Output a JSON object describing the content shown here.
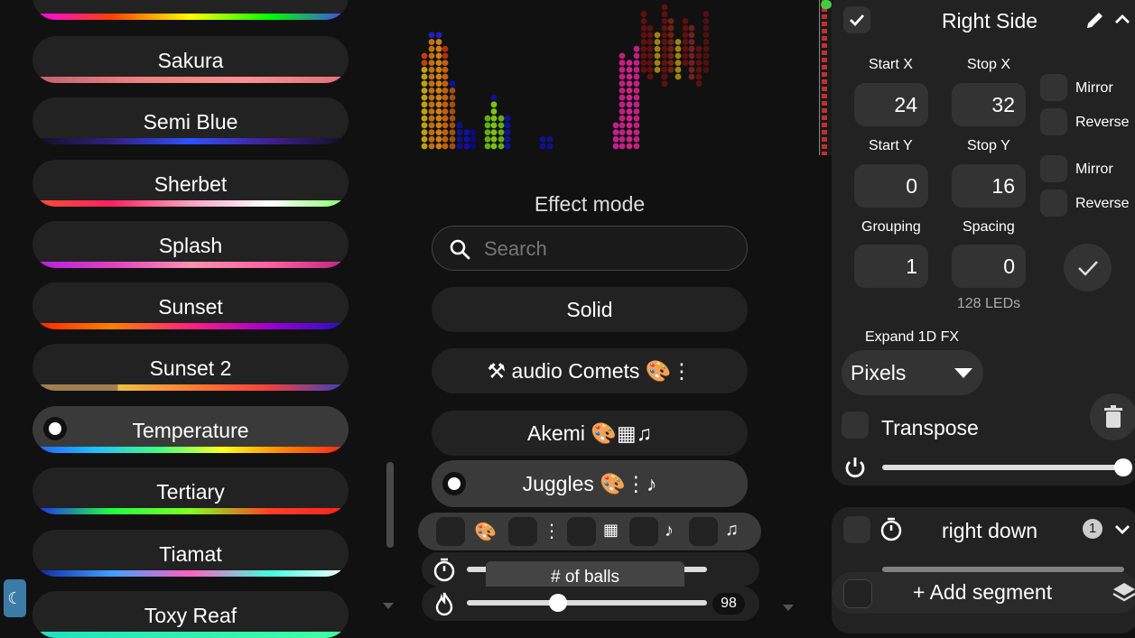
{
  "palettes": {
    "items": [
      {
        "label": "Sakura",
        "gradient": [
          "#c06070",
          "#f08080",
          "#ff9090",
          "#e0707a"
        ]
      },
      {
        "label": "Semi Blue",
        "gradient": [
          "#101020",
          "#302080",
          "#3050ff",
          "#402090",
          "#101020"
        ]
      },
      {
        "label": "Sherbet",
        "gradient": [
          "#ff5030",
          "#ff2060",
          "#ffa0c0",
          "#ffffff",
          "#80ff60"
        ]
      },
      {
        "label": "Splash",
        "gradient": [
          "#b020e0",
          "#e040c0",
          "#ff90b0",
          "#ff60a0",
          "#c02080"
        ]
      },
      {
        "label": "Sunset",
        "gradient": [
          "#ff2000",
          "#ff8000",
          "#ff2080",
          "#a000d0",
          "#2010c0"
        ]
      },
      {
        "label": "Sunset 2",
        "gradient": [
          "#a08050",
          "#a08050",
          "#f0c040",
          "#ff7030",
          "#f04040",
          "#3040c0"
        ]
      },
      {
        "label": "Temperature",
        "gradient": [
          "#2060ff",
          "#20c0ff",
          "#40ff80",
          "#ffff20",
          "#ff8000",
          "#ff2020"
        ]
      },
      {
        "label": "Tertiary",
        "gradient": [
          "#2020ff",
          "#20ff40",
          "#80ff20",
          "#ff4020",
          "#ff2020"
        ]
      },
      {
        "label": "Tiamat",
        "gradient": [
          "#1020a0",
          "#40a0ff",
          "#ff60c0",
          "#40ffe0",
          "#ffffff"
        ]
      },
      {
        "label": "Toxy Reaf",
        "gradient": [
          "#20e0c0",
          "#40ffa0"
        ]
      }
    ],
    "top_partial_gradient": [
      "#ff00ff",
      "#ff4000",
      "#ffff00",
      "#00ff00",
      "#4040ff"
    ]
  },
  "effects": {
    "title": "Effect mode",
    "search_placeholder": "Search",
    "items": [
      {
        "label": "Solid"
      },
      {
        "label": "⚒ audio Comets 🎨⋮"
      },
      {
        "label": "Akemi 🎨▦♫"
      },
      {
        "label": "Juggles 🎨⋮♪"
      }
    ],
    "filter_icons": [
      "🎨",
      "⋮",
      "▦",
      "♪",
      "♫"
    ],
    "slider1": {
      "tooltip": "# of balls",
      "value": 0.5
    },
    "slider2": {
      "value_text": "98",
      "value": 0.38
    }
  },
  "segment": {
    "name": "Right Side",
    "start_x_label": "Start X",
    "start_x": "24",
    "stop_x_label": "Stop X",
    "stop_x": "32",
    "start_y_label": "Start Y",
    "start_y": "0",
    "stop_y_label": "Stop Y",
    "stop_y": "16",
    "grouping_label": "Grouping",
    "grouping": "1",
    "spacing_label": "Spacing",
    "spacing": "0",
    "mirror_label": "Mirror",
    "reverse_label": "Reverse",
    "leds": "128 LEDs",
    "expand_label": "Expand 1D FX",
    "expand_value": "Pixels",
    "transpose_label": "Transpose",
    "brightness": 1.0
  },
  "segment2": {
    "name": "right down",
    "badge": "1"
  },
  "add_segment_label": "Add segment",
  "colors": {
    "accent_green": "#22c55e",
    "panel": "#222222"
  }
}
